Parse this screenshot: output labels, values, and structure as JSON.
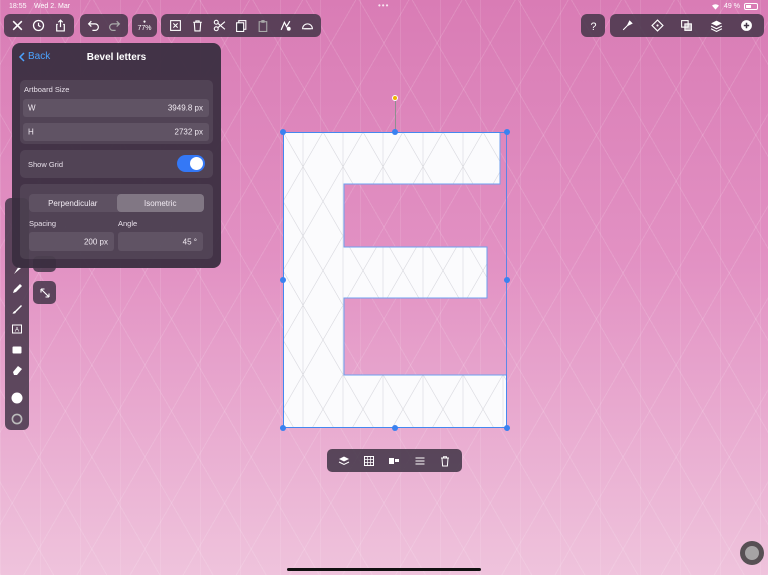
{
  "status_bar": {
    "time": "18:55",
    "date": "Wed 2. Mar",
    "battery": "49 %"
  },
  "toolbar": {
    "zoom": "77%",
    "left_icons": [
      "close-icon",
      "history-icon",
      "share-icon"
    ],
    "undo_icons": [
      "undo-icon",
      "redo-icon"
    ],
    "edit_icons": [
      "deselect-icon",
      "trash-icon",
      "scissors-icon",
      "copy-icon",
      "paste-icon",
      "clone-icon",
      "flip-icon"
    ],
    "right_icons": [
      "help-icon",
      "pen-tools-icon",
      "vector-icon",
      "boolean-icon",
      "layers-icon",
      "add-icon"
    ]
  },
  "panel": {
    "back_label": "Back",
    "title": "Bevel letters",
    "artboard_size_label": "Artboard Size",
    "width_label": "W",
    "width_value": "3949.8 px",
    "height_label": "H",
    "height_value": "2732 px",
    "show_grid_label": "Show Grid",
    "show_grid_on": true,
    "grid_types": [
      "Perpendicular",
      "Isometric"
    ],
    "grid_type_selected": "Isometric",
    "spacing_label": "Spacing",
    "spacing_value": "200 px",
    "angle_label": "Angle",
    "angle_value": "45 °"
  },
  "artboard": {
    "shape": "letter-E",
    "selection_color": "#3a82f0"
  },
  "bottom_bar_icons": [
    "arrange-icon",
    "pattern-icon",
    "align-icon",
    "menu-icon",
    "trash-icon"
  ],
  "colors": {
    "accent": "#3478f6",
    "background_top": "#d97cb5",
    "background_bottom": "#efc3dc",
    "rotation_handle": "#f0b400"
  }
}
